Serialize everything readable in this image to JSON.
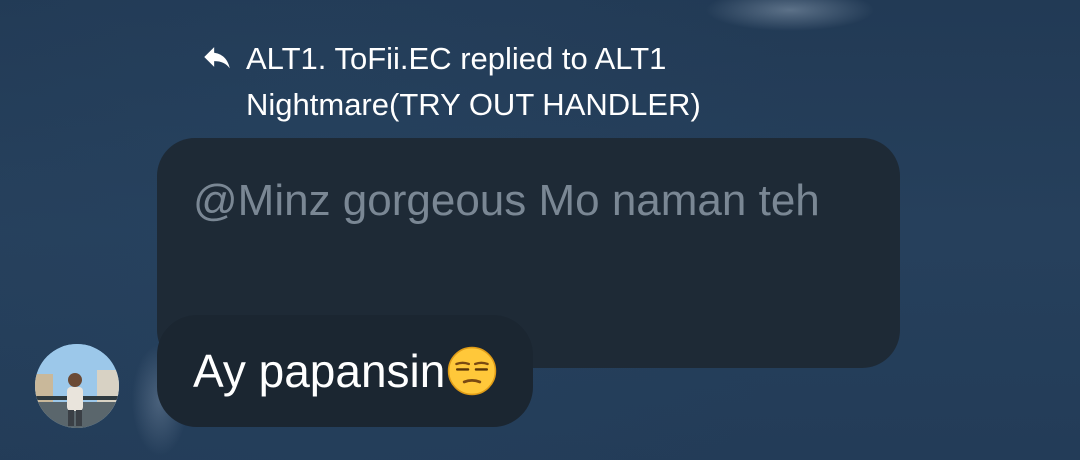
{
  "reply": {
    "text": "ALT1. ToFii.EC replied to ALT1 Nightmare(TRY OUT HANDLER)"
  },
  "quoted_message": {
    "text": "@Minz gorgeous Mo naman teh"
  },
  "message": {
    "text": "Ay papansin",
    "emoji": "unamused-face"
  },
  "avatar": {
    "description": "profile-photo"
  },
  "colors": {
    "background": "#233c58",
    "quoted_bubble": "#1e2a36",
    "message_bubble": "#1b2631",
    "quoted_text": "#7a8794",
    "message_text": "#ffffff"
  }
}
